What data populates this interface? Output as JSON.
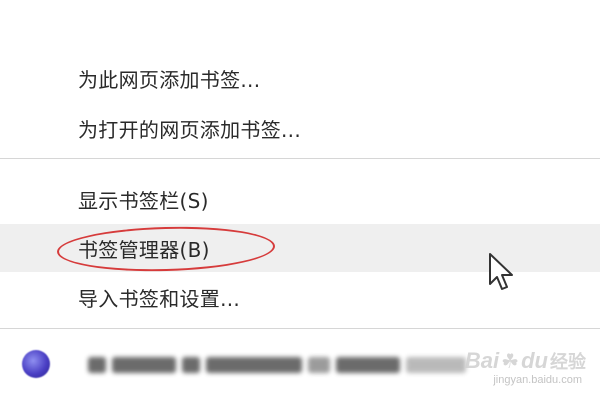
{
  "menu": {
    "items": [
      {
        "label": "为此网页添加书签..."
      },
      {
        "label": "为打开的网页添加书签..."
      },
      {
        "label": "显示书签栏(S)"
      },
      {
        "label": "书签管理器(B)"
      },
      {
        "label": "导入书签和设置..."
      }
    ],
    "highlighted_index": 3
  },
  "annotation": {
    "ellipse_color": "#d63b3b"
  },
  "bookmark": {
    "favicon_icon": "globe-favicon-icon"
  },
  "watermark": {
    "main": "Bai",
    "paw": "du",
    "suffix": "经验",
    "sub": "jingyan.baidu.com"
  },
  "colors": {
    "highlight": "#efefef",
    "separator": "#d6d6d6",
    "text": "#2a2a2a"
  }
}
